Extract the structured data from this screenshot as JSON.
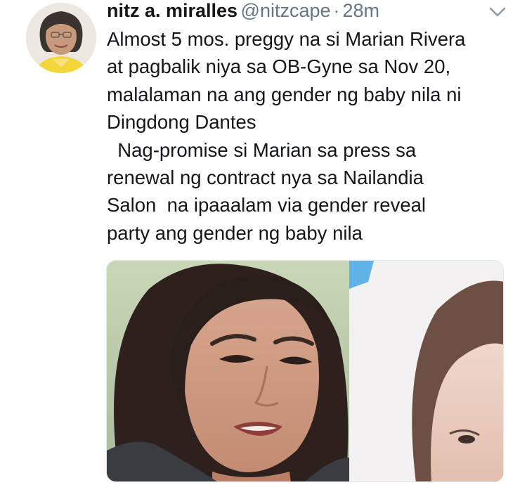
{
  "tweet": {
    "display_name": "nitz a. miralles",
    "handle": "@nitzcape",
    "separator": "·",
    "time": "28m",
    "text": "Almost 5 mos. preggy na si Marian Rivera\nat pagbalik niya sa OB-Gyne sa Nov 20,\nmalalaman na ang gender ng baby nila ni\nDingdong Dantes\n  Nag-promise si Marian sa press sa\nrenewal ng contract nya sa Nailandia\nSalon  na ipaaalam via gender reveal\nparty ang gender ng baby nila",
    "avatar_icon": "profile-photo",
    "menu_icon": "chevron-down-icon",
    "media_description_icon": "attached-photo"
  },
  "colors": {
    "text": "#14171a",
    "secondary": "#657786",
    "border": "#e1e8ed"
  }
}
